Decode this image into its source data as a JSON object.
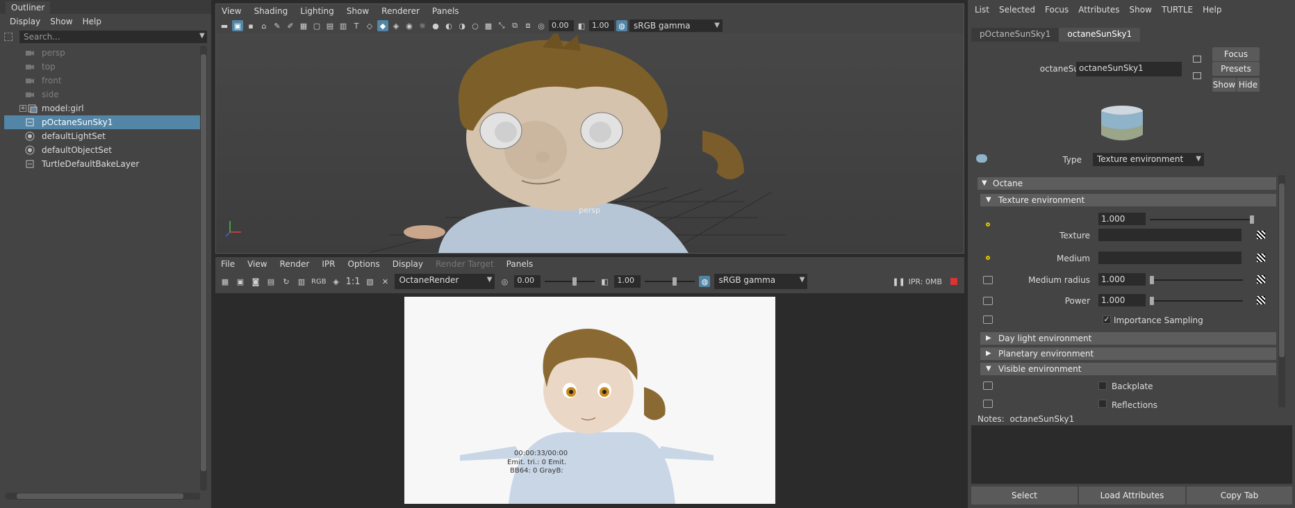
{
  "outliner": {
    "tab": "Outliner",
    "menu": [
      "Display",
      "Show",
      "Help"
    ],
    "search_placeholder": "Search...",
    "items": [
      {
        "label": "persp",
        "dim": true
      },
      {
        "label": "top",
        "dim": true
      },
      {
        "label": "front",
        "dim": true
      },
      {
        "label": "side",
        "dim": true
      },
      {
        "label": "model:girl",
        "dim": false
      },
      {
        "label": "pOctaneSunSky1",
        "dim": false,
        "selected": true
      },
      {
        "label": "defaultLightSet",
        "dim": false
      },
      {
        "label": "defaultObjectSet",
        "dim": false
      },
      {
        "label": "TurtleDefaultBakeLayer",
        "dim": false
      }
    ]
  },
  "viewport": {
    "menu": [
      "View",
      "Shading",
      "Lighting",
      "Show",
      "Renderer",
      "Panels"
    ],
    "exposure": "0.00",
    "gamma": "1.00",
    "color_space": "sRGB gamma",
    "camera_label": "persp"
  },
  "render_view": {
    "menu": [
      "File",
      "View",
      "Render",
      "IPR",
      "Options",
      "Display",
      "Render Target",
      "Panels"
    ],
    "ratio_label": "1:1",
    "rgb_label": "RGB",
    "renderer": "OctaneRender",
    "exposure": "0.00",
    "gamma": "1.00",
    "color_space": "sRGB gamma",
    "ipr_status": "IPR: 0MB",
    "stats_line1": "00:00:33/00:00",
    "stats_line2": "Emit. tri.: 0 Emit.",
    "stats_line3": "BB64: 0 GrayB:"
  },
  "attribute_editor": {
    "menu": [
      "List",
      "Selected",
      "Focus",
      "Attributes",
      "Show",
      "TURTLE",
      "Help"
    ],
    "tabs": [
      "pOctaneSunSky1",
      "octaneSunSky1"
    ],
    "node_label": "octaneSunSky:",
    "node_value": "octaneSunSky1",
    "focus": "Focus",
    "presets": "Presets",
    "show": "Show",
    "hide": "Hide",
    "type_label": "Type",
    "type_value": "Texture environment",
    "sections": {
      "octane": "Octane",
      "texture_env": "Texture environment",
      "day_light": "Day light environment",
      "planetary": "Planetary environment",
      "visible": "Visible environment"
    },
    "rows": {
      "value": "1.000",
      "texture": "Texture",
      "medium": "Medium",
      "medium_radius": "Medium radius",
      "medium_radius_value": "1.000",
      "power": "Power",
      "power_value": "1.000",
      "importance_sampling": "Importance Sampling",
      "backplate": "Backplate",
      "reflections": "Reflections"
    },
    "notes_label": "Notes:",
    "notes_value": "octaneSunSky1",
    "buttons": {
      "select": "Select",
      "load": "Load Attributes",
      "copy": "Copy Tab"
    }
  },
  "colors": {
    "selection": "#5285a6",
    "panel": "#444444",
    "field": "#2b2b2b"
  }
}
